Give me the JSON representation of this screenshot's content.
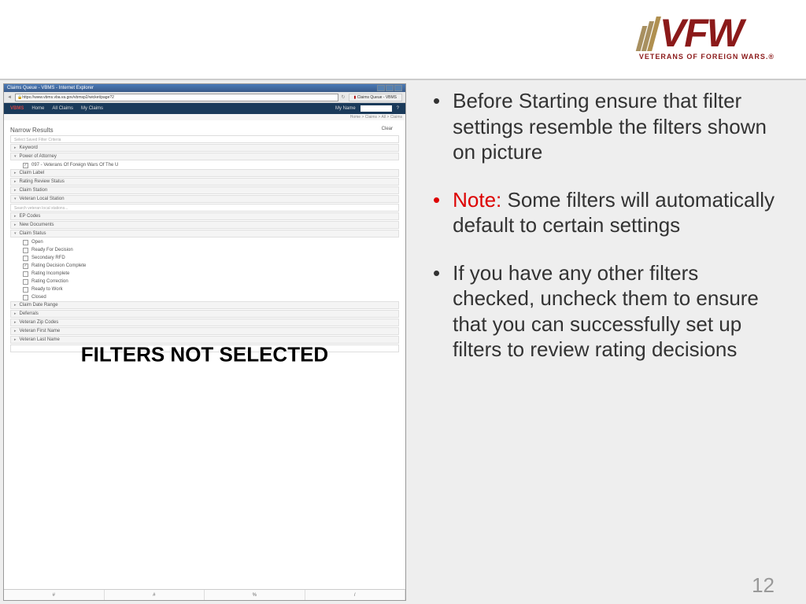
{
  "logo": {
    "main": "VFW",
    "sub": "VETERANS OF FOREIGN WARS.®"
  },
  "page_number": "12",
  "bullets": {
    "b1": "Before Starting ensure that filter settings resemble the filters shown on picture",
    "note_label": "Note:",
    "b2": " Some filters will automatically default to certain settings",
    "b3": "If you have any other filters checked, uncheck them to ensure that you can successfully set up filters to review rating decisions"
  },
  "overlay": "FILTERS NOT SELECTED",
  "screenshot": {
    "title": "Claims Queue - VBMS - Internet Explorer",
    "url": "https://www.vbms.vba.va.gov/vbmsp2/wicket/page?2",
    "tab": "Claims Queue - VBMS",
    "nav": {
      "logo": "VBMS",
      "items": [
        "Home",
        "All Claims",
        "My Claims"
      ],
      "user": "My Name"
    },
    "breadcrumb": "Home > Claims > All > Claims",
    "section": "Narrow Results",
    "clear": "Clear",
    "saved_filter": "Select Saved Filter Criteria",
    "filters": [
      {
        "label": "Keyword",
        "expanded": false
      },
      {
        "label": "Power of Attorney",
        "expanded": true,
        "child": "097 - Veterans Of Foreign Wars Of The U"
      },
      {
        "label": "Claim Label",
        "expanded": false
      },
      {
        "label": "Rating Review Status",
        "expanded": false
      },
      {
        "label": "Claim Station",
        "expanded": false
      },
      {
        "label": "Veteran Local Station",
        "expanded": true,
        "input": "Search veteran local stations..."
      },
      {
        "label": "EP Codes",
        "expanded": false
      },
      {
        "label": "New Documents",
        "expanded": false
      },
      {
        "label": "Claim Status",
        "expanded": true,
        "checks": [
          "Open",
          "Ready For Decision",
          "Secondary RFD",
          "Rating Decision Complete",
          "Rating Incomplete",
          "Rating Correction",
          "Ready to Work",
          "Closed"
        ]
      },
      {
        "label": "Claim Date Range",
        "expanded": false
      },
      {
        "label": "Deferrals",
        "expanded": false
      },
      {
        "label": "Veteran Zip Codes",
        "expanded": false
      },
      {
        "label": "Veteran First Name",
        "expanded": false
      },
      {
        "label": "Veteran Last Name",
        "expanded": false
      }
    ],
    "footer_cols": [
      "#",
      "#",
      "%",
      "/"
    ]
  }
}
